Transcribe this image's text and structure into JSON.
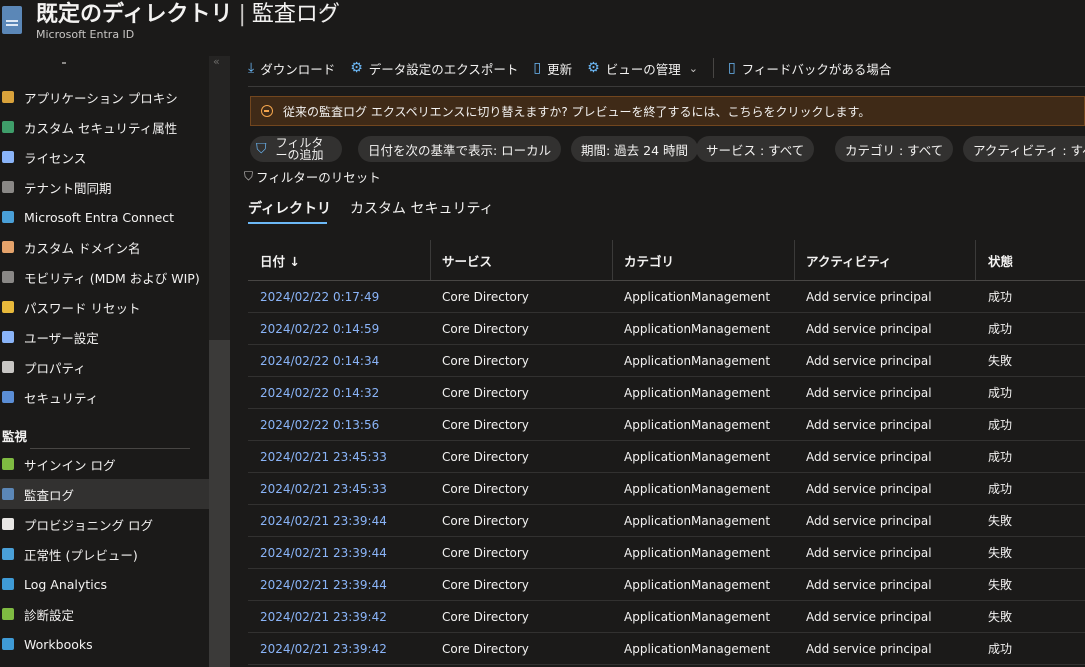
{
  "header": {
    "title": "既定のディレクトリ",
    "separator": "|",
    "page": "監査ログ",
    "more": "···",
    "subtitle": "Microsoft Entra ID"
  },
  "sidebar": {
    "collapse": "«",
    "items": [
      {
        "label": "アプリケーション プロキシ",
        "icon": "app-proxy-icon",
        "color": "#d9a23b"
      },
      {
        "label": "カスタム セキュリティ属性",
        "icon": "custom-attributes-icon",
        "color": "#3f9e6a"
      },
      {
        "label": "ライセンス",
        "icon": "licenses-icon",
        "color": "#8ab4f8"
      },
      {
        "label": "テナント間同期",
        "icon": "cross-tenant-sync-icon",
        "color": "#8a8886"
      },
      {
        "label": "Microsoft Entra Connect",
        "icon": "entra-connect-icon",
        "color": "#4aa0d8"
      },
      {
        "label": "カスタム ドメイン名",
        "icon": "custom-domain-icon",
        "color": "#e5a36b"
      },
      {
        "label": "モビリティ (MDM および WIP)",
        "icon": "mobility-icon",
        "color": "#8a8886"
      },
      {
        "label": "パスワード リセット",
        "icon": "password-reset-icon",
        "color": "#e8b93b"
      },
      {
        "label": "ユーザー設定",
        "icon": "user-settings-icon",
        "color": "#8ab4f8"
      },
      {
        "label": "プロパティ",
        "icon": "properties-icon",
        "color": "#c8c6c4"
      },
      {
        "label": "セキュリティ",
        "icon": "security-icon",
        "color": "#5b8ed6"
      }
    ],
    "section": "監視",
    "monitor_items": [
      {
        "label": "サインイン ログ",
        "icon": "sign-in-logs-icon",
        "color": "#7fba42"
      },
      {
        "label": "監査ログ",
        "icon": "audit-logs-icon",
        "color": "#5b87b7",
        "active": true
      },
      {
        "label": "プロビジョニング ログ",
        "icon": "provisioning-logs-icon",
        "color": "#e8e6e4"
      },
      {
        "label": "正常性 (プレビュー)",
        "icon": "health-icon",
        "color": "#4aa0d8"
      },
      {
        "label": "Log Analytics",
        "icon": "log-analytics-icon",
        "color": "#3f9bd6"
      },
      {
        "label": "診断設定",
        "icon": "diagnostic-settings-icon",
        "color": "#7fba42"
      },
      {
        "label": "Workbooks",
        "icon": "workbooks-icon",
        "color": "#3f9bd6"
      }
    ]
  },
  "toolbar": {
    "download": "ダウンロード",
    "export": "データ設定のエクスポート",
    "refresh": "更新",
    "manage_view": "ビューの管理",
    "feedback": "フィードバックがある場合"
  },
  "banner": {
    "text": "従来の監査ログ エクスペリエンスに切り替えますか? プレビューを終了するには、こちらをクリックします。"
  },
  "filters": {
    "add": "フィルターの追加",
    "date_display": "日付を次の基準で表示: ローカル",
    "period": "期間: 過去 24 時間",
    "service": "サービス : すべて",
    "category": "カテゴリ : すべて",
    "activity": "アクティビティ : すべて",
    "reset": "フィルターのリセット"
  },
  "tabs": {
    "directory": "ディレクトリ",
    "custom_security": "カスタム セキュリティ"
  },
  "table": {
    "columns": [
      "日付 ↓",
      "サービス",
      "カテゴリ",
      "アクティビティ",
      "状態"
    ],
    "rows": [
      [
        "2024/02/22 0:17:49",
        "Core Directory",
        "ApplicationManagement",
        "Add service principal",
        "成功"
      ],
      [
        "2024/02/22 0:14:59",
        "Core Directory",
        "ApplicationManagement",
        "Add service principal",
        "成功"
      ],
      [
        "2024/02/22 0:14:34",
        "Core Directory",
        "ApplicationManagement",
        "Add service principal",
        "失敗"
      ],
      [
        "2024/02/22 0:14:32",
        "Core Directory",
        "ApplicationManagement",
        "Add service principal",
        "成功"
      ],
      [
        "2024/02/22 0:13:56",
        "Core Directory",
        "ApplicationManagement",
        "Add service principal",
        "成功"
      ],
      [
        "2024/02/21 23:45:33",
        "Core Directory",
        "ApplicationManagement",
        "Add service principal",
        "成功"
      ],
      [
        "2024/02/21 23:45:33",
        "Core Directory",
        "ApplicationManagement",
        "Add service principal",
        "成功"
      ],
      [
        "2024/02/21 23:39:44",
        "Core Directory",
        "ApplicationManagement",
        "Add service principal",
        "失敗"
      ],
      [
        "2024/02/21 23:39:44",
        "Core Directory",
        "ApplicationManagement",
        "Add service principal",
        "失敗"
      ],
      [
        "2024/02/21 23:39:44",
        "Core Directory",
        "ApplicationManagement",
        "Add service principal",
        "失敗"
      ],
      [
        "2024/02/21 23:39:42",
        "Core Directory",
        "ApplicationManagement",
        "Add service principal",
        "失敗"
      ],
      [
        "2024/02/21 23:39:42",
        "Core Directory",
        "ApplicationManagement",
        "Add service principal",
        "成功"
      ]
    ]
  }
}
